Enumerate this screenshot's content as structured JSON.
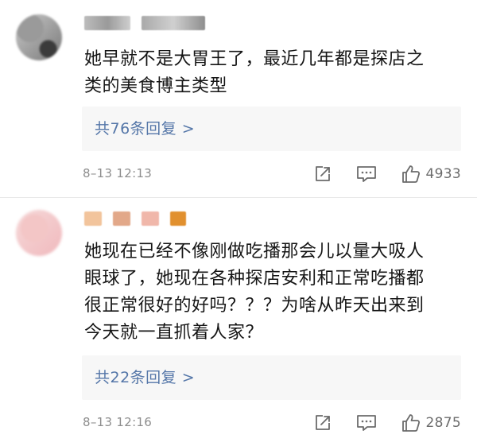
{
  "comments": [
    {
      "avatar_icon": "user-avatar-blurred",
      "username": "",
      "text": "她早就不是大胃王了，最近几年都是探店之\n类的美食博主类型",
      "replies_label": "共76条回复 >",
      "timestamp": "8–13 12:13",
      "likes": "4933"
    },
    {
      "avatar_icon": "user-avatar-blurred",
      "username": "",
      "text": "她现在已经不像刚做吃播那会儿以量大吸人\n眼球了，她现在各种探店安利和正常吃播都\n很正常很好的好吗？？？为啥从昨天出来到\n今天就一直抓着人家？",
      "replies_label": "共22条回复 >",
      "timestamp": "8–13 12:16",
      "likes": "2875"
    }
  ],
  "icons": {
    "share": "share-icon",
    "comment": "comment-icon",
    "like": "thumbs-up-icon"
  },
  "colors": {
    "reply_link": "#5476a8",
    "meta_text": "#8d8d8d",
    "reply_box_bg": "#f7f7f7"
  }
}
